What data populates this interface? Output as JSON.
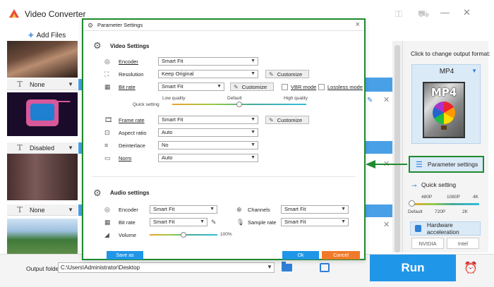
{
  "app": {
    "title": "Video Converter"
  },
  "toolbar": {
    "add_files": "Add Files"
  },
  "file_list": {
    "subtitle_rows": [
      {
        "value": "None"
      },
      {
        "value": "Disabled"
      },
      {
        "value": "None"
      }
    ]
  },
  "right_panel": {
    "change_format_label": "Click to change output format:",
    "format": "MP4",
    "format_art_text": "MP4",
    "parameter_settings_label": "Parameter settings",
    "quick_setting_label": "Quick setting",
    "quick_setting_top_ticks": [
      "480P",
      "1080P",
      "4K"
    ],
    "quick_setting_bottom_ticks": [
      "Default",
      "720P",
      "2K"
    ],
    "quick_setting_value": 0,
    "hw_accel_label": "Hardware acceleration",
    "gpu_chips": [
      "NVIDIA",
      "Intel"
    ]
  },
  "bottom": {
    "output_folder_label": "Output folder:",
    "output_folder_value": "C:\\Users\\Administrator\\Desktop",
    "run_label": "Run"
  },
  "dialog": {
    "title": "Parameter Settings",
    "video_settings_title": "Video Settings",
    "video": {
      "encoder_label": "Encoder",
      "encoder_value": "Smart Fit",
      "resolution_label": "Resolution",
      "resolution_value": "Keep Original",
      "bitrate_label": "Bit rate",
      "bitrate_value": "Smart Fit",
      "vbr_label": "VBR mode",
      "lossless_label": "Lossless mode",
      "quality_low": "Low quality",
      "quality_default": "Default",
      "quality_high": "High quality",
      "quick_setting_label": "Quick setting",
      "quality_value": 0.5,
      "framerate_label": "Frame rate",
      "framerate_value": "Smart Fit",
      "aspect_label": "Aspect ratio",
      "aspect_value": "Auto",
      "deinterlace_label": "Deinterlace",
      "deinterlace_value": "No",
      "norm_label": "Norm",
      "norm_value": "Auto",
      "customize_label": "Customize"
    },
    "audio_settings_title": "Audio settings",
    "audio": {
      "encoder_label": "Encoder",
      "encoder_value": "Smart Fit",
      "channels_label": "Channels",
      "channels_value": "Smart Fit",
      "bitrate_label": "Bit rate",
      "bitrate_value": "Smart Fit",
      "samplerate_label": "Sample rate",
      "samplerate_value": "Smart Fit",
      "volume_label": "Volume",
      "volume_value": "100%",
      "volume_level": 0.5
    },
    "save_as_label": "Save as",
    "ok_label": "Ok",
    "cancel_label": "Cancel"
  },
  "colors": {
    "accent": "#2096e8",
    "highlight_border": "#1f8a2e",
    "cancel": "#f07a2a"
  }
}
